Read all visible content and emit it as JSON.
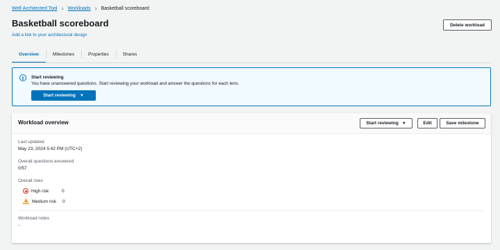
{
  "breadcrumb": {
    "root": "Well-Architected Tool",
    "section": "Workloads",
    "current": "Basketball scoreboard"
  },
  "header": {
    "title": "Basketball scoreboard",
    "design_link": "Add a link to your architectural design",
    "delete_label": "Delete workload"
  },
  "tabs": [
    "Overview",
    "Milestones",
    "Properties",
    "Shares"
  ],
  "alert": {
    "title": "Start reviewing",
    "body": "You have unanswered questions. Start reviewing your workload and answer the questions for each lens.",
    "button_label": "Start reviewing"
  },
  "overview": {
    "title": "Workload overview",
    "start_label": "Start reviewing",
    "edit_label": "Edit",
    "milestone_label": "Save milestone",
    "last_updated_label": "Last updated",
    "last_updated_value": "May 23, 2024 5:42 PM (UTC+2)",
    "questions_label": "Overall questions answered",
    "questions_value": "0/57",
    "risks_label": "Overall risks",
    "risks": [
      {
        "label": "High risk",
        "count": "0"
      },
      {
        "label": "Medium risk",
        "count": "0"
      }
    ],
    "notes_label": "Workload notes",
    "notes_value": "-"
  },
  "colors": {
    "link": "#0073bb",
    "primary_button": "#0073bb",
    "high_risk": "#d13212",
    "medium_risk": "#ff9900"
  }
}
